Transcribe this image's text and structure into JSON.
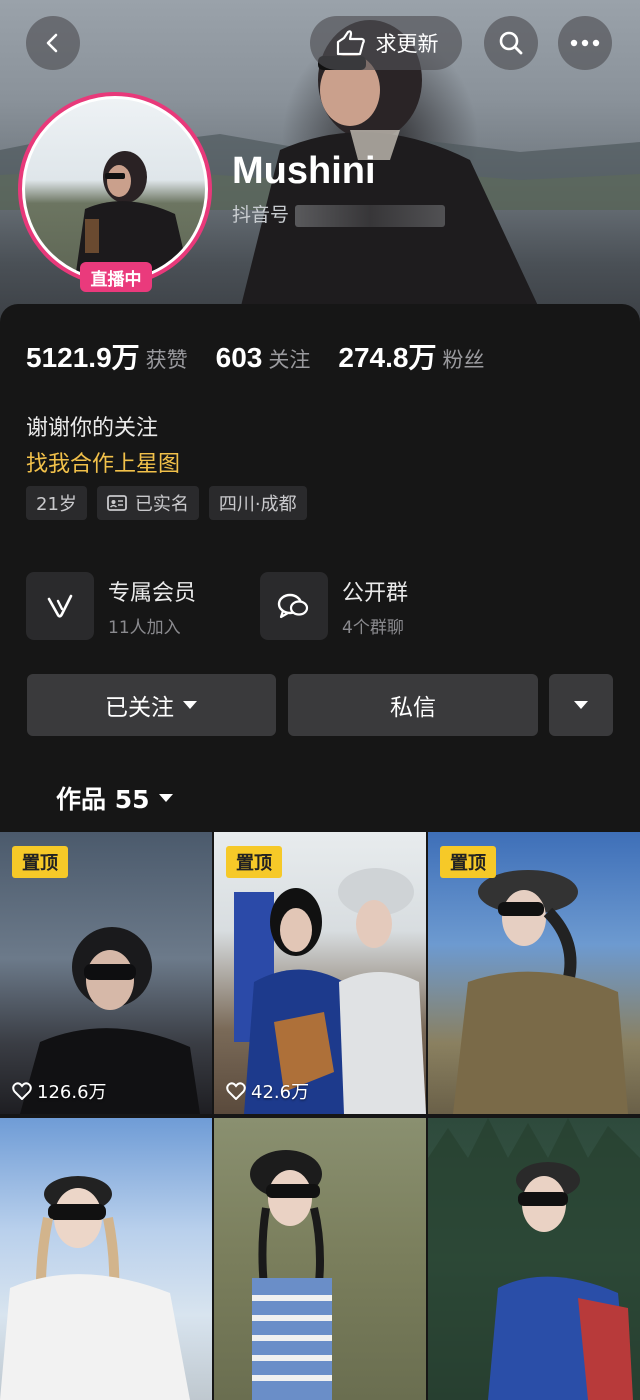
{
  "header": {
    "update_request_label": "求更新",
    "username": "Mushini",
    "douyin_id_prefix": "抖音号",
    "live_badge": "直播中"
  },
  "stats": [
    {
      "value": "5121.9万",
      "label": "获赞"
    },
    {
      "value": "603",
      "label": "关注"
    },
    {
      "value": "274.8万",
      "label": "粉丝"
    }
  ],
  "bio": {
    "line1": "谢谢你的关注",
    "line2": "找我合作上星图"
  },
  "tags": {
    "age": "21岁",
    "verified": "已实名",
    "location": "四川·成都"
  },
  "features": {
    "membership": {
      "title": "专属会员",
      "sub": "11人加入"
    },
    "group": {
      "title": "公开群",
      "sub": "4个群聊"
    }
  },
  "actions": {
    "followed": "已关注",
    "message": "私信"
  },
  "works": {
    "label": "作品 55",
    "pin_label": "置顶",
    "items": [
      {
        "likes": "126.6万",
        "pinned": true
      },
      {
        "likes": "42.6万",
        "pinned": true
      },
      {
        "likes": "",
        "pinned": true
      },
      {
        "likes": "",
        "pinned": false
      },
      {
        "likes": "",
        "pinned": false
      },
      {
        "likes": "",
        "pinned": false
      }
    ]
  },
  "colors": {
    "accent_pink": "#ea3a7c",
    "highlight_yellow": "#f2c14a",
    "pin_yellow": "#f6c928",
    "background": "#161616"
  }
}
